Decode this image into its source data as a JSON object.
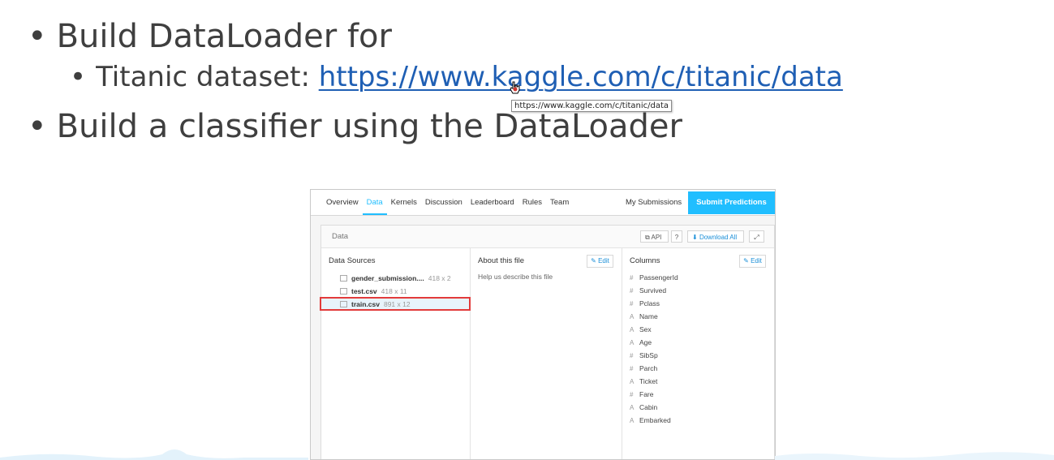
{
  "slide": {
    "bullet1": "Build DataLoader for",
    "bullet2_prefix": "Titanic dataset: ",
    "bullet2_link": "https://www.kaggle.com/c/titanic/data",
    "bullet3": "Build a classifier using the DataLoader",
    "bullet_char": "•",
    "tooltip": "https://www.kaggle.com/c/titanic/data",
    "link_color": "#1f5fb4"
  },
  "kaggle": {
    "tabs": [
      "Overview",
      "Data",
      "Kernels",
      "Discussion",
      "Leaderboard",
      "Rules",
      "Team"
    ],
    "active_tab": "Data",
    "my_submissions": "My Submissions",
    "submit_predictions": "Submit Predictions",
    "accent_color": "#20beff",
    "panel_title": "Data",
    "api_label": "API",
    "help_label": "?",
    "download_all": "Download All",
    "expand_icon": "expand-icon",
    "data_sources_title": "Data Sources",
    "files": [
      {
        "name": "gender_submission....",
        "size": "418 x 2"
      },
      {
        "name": "test.csv",
        "size": "418 x 11"
      },
      {
        "name": "train.csv",
        "size": "891 x 12"
      }
    ],
    "selected_file": "train.csv",
    "about_title": "About this file",
    "edit_label": "Edit",
    "about_text": "Help us describe this file",
    "columns_title": "Columns",
    "columns": [
      {
        "type": "#",
        "name": "PassengerId"
      },
      {
        "type": "#",
        "name": "Survived"
      },
      {
        "type": "#",
        "name": "Pclass"
      },
      {
        "type": "A",
        "name": "Name"
      },
      {
        "type": "A",
        "name": "Sex"
      },
      {
        "type": "A",
        "name": "Age"
      },
      {
        "type": "#",
        "name": "SibSp"
      },
      {
        "type": "#",
        "name": "Parch"
      },
      {
        "type": "A",
        "name": "Ticket"
      },
      {
        "type": "#",
        "name": "Fare"
      },
      {
        "type": "A",
        "name": "Cabin"
      },
      {
        "type": "A",
        "name": "Embarked"
      }
    ]
  }
}
